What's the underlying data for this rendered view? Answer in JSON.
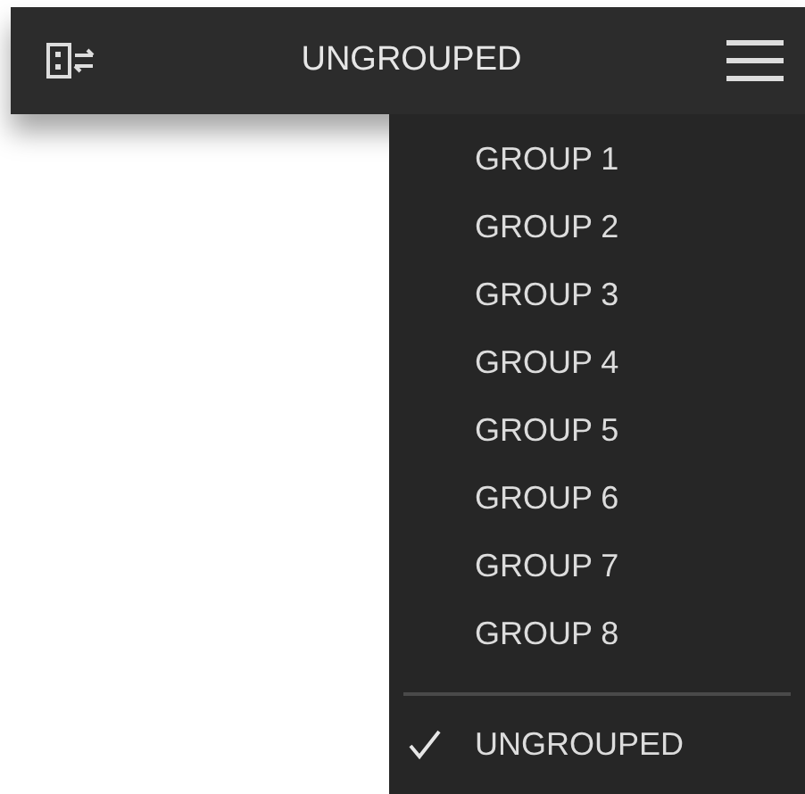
{
  "header": {
    "title": "UNGROUPED"
  },
  "menu": {
    "items": [
      {
        "label": "GROUP 1",
        "selected": false
      },
      {
        "label": "GROUP 2",
        "selected": false
      },
      {
        "label": "GROUP 3",
        "selected": false
      },
      {
        "label": "GROUP 4",
        "selected": false
      },
      {
        "label": "GROUP 5",
        "selected": false
      },
      {
        "label": "GROUP 6",
        "selected": false
      },
      {
        "label": "GROUP 7",
        "selected": false
      },
      {
        "label": "GROUP 8",
        "selected": false
      }
    ],
    "footer_item": {
      "label": "UNGROUPED",
      "selected": true
    }
  }
}
